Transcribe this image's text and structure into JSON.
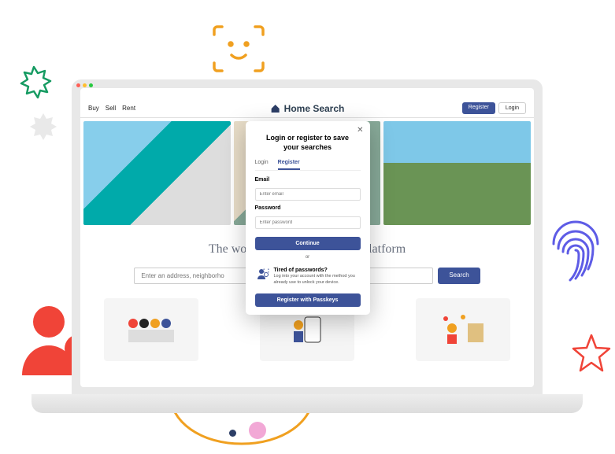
{
  "brand": {
    "name": "Home Search"
  },
  "nav": {
    "buy": "Buy",
    "sell": "Sell",
    "rent": "Rent"
  },
  "auth": {
    "register": "Register",
    "login": "Login"
  },
  "hero": {
    "tagline": "The world's best house search platform"
  },
  "search": {
    "placeholder": "Enter an address, neighborho",
    "button": "Search"
  },
  "modal": {
    "title": "Login or register to save your searches",
    "tabs": {
      "login": "Login",
      "register": "Register"
    },
    "email": {
      "label": "Email",
      "placeholder": "Enter email"
    },
    "password": {
      "label": "Password",
      "placeholder": "Enter password"
    },
    "continue": "Continue",
    "or": "or",
    "passkey": {
      "title": "Tired of passwords?",
      "desc": "Log into your account with the method you already use to unlock your device.",
      "button": "Register with Passkeys"
    }
  },
  "colors": {
    "primary": "#3d5399",
    "accent_orange": "#f0a020",
    "red": "#f04438",
    "green": "#169b62",
    "purple": "#5e5ce6"
  }
}
